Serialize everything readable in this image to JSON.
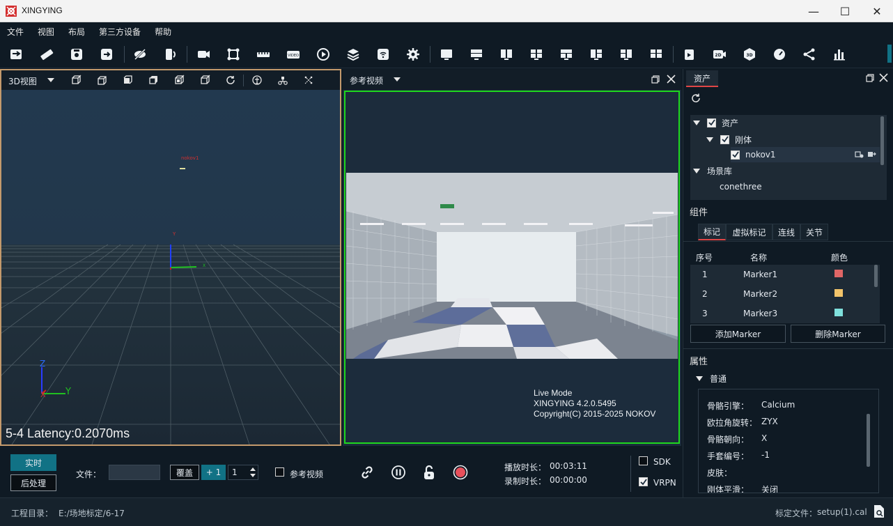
{
  "window": {
    "title": "XINGYING",
    "minimize": "—",
    "maximize": "☐",
    "close": "✕"
  },
  "menu": [
    "文件",
    "视图",
    "布局",
    "第三方设备",
    "帮助"
  ],
  "view3d": {
    "mode_label": "3D视图",
    "rigid_label": "nokov1",
    "axis_y_top": "Y",
    "axis_x_right": "X",
    "axis_z": "Z",
    "axis_x": "X",
    "axis_y": "Y",
    "latency": "5-4 Latency:0.2070ms"
  },
  "refvideo": {
    "title": "参考视频",
    "info": [
      "Live Mode",
      "XINGYING 4.2.0.5495",
      "Copyright(C) 2015-2025 NOKOV"
    ]
  },
  "assets": {
    "tab": "资产",
    "tree": {
      "root": "资产",
      "rigid_group": "刚体",
      "rigid_item": "nokov1",
      "scene_lib": "场景库",
      "scene_item": "conethree"
    },
    "components_label": "组件",
    "component_tabs": [
      "标记",
      "虚拟标记",
      "连线",
      "关节"
    ],
    "table_headers": [
      "序号",
      "名称",
      "颜色"
    ],
    "markers": [
      {
        "index": "1",
        "name": "Marker1",
        "color": "#e06666"
      },
      {
        "index": "2",
        "name": "Marker2",
        "color": "#f3c46a"
      },
      {
        "index": "3",
        "name": "Marker3",
        "color": "#7fe0dc"
      }
    ],
    "add_marker": "添加Marker",
    "del_marker": "删除Marker",
    "props_label": "属性",
    "props_group": "普通",
    "props": [
      {
        "k": "骨骼引擎：",
        "v": "Calcium"
      },
      {
        "k": "欧拉角旋转：",
        "v": "ZYX"
      },
      {
        "k": "骨骼朝向：",
        "v": "X"
      },
      {
        "k": "手套编号：",
        "v": "-1"
      },
      {
        "k": "皮肤：",
        "v": ""
      },
      {
        "k": "刚体平滑：",
        "v": "关闭"
      }
    ]
  },
  "bottom": {
    "realtime": "实时",
    "postproc": "后处理",
    "file_label": "文件：",
    "file_value": "",
    "overwrite": "覆盖",
    "plus_one": "+ 1",
    "spin_value": "1",
    "refvideo_label": "参考视频",
    "play_len_label": "播放时长：",
    "play_len": "00:03:11",
    "rec_len_label": "录制时长：",
    "rec_len": "00:00:00",
    "sdk": "SDK",
    "vrpn": "VRPN"
  },
  "status": {
    "project_label": "工程目录：",
    "project_path": "E:/场地标定/6-17",
    "calib_label": "标定文件：",
    "calib_file": "setup(1).cal"
  },
  "colors": {
    "accent": "#117285",
    "frame_green": "#1ed81e",
    "frame_3d": "#c49a6c",
    "record": "#e8505b"
  }
}
